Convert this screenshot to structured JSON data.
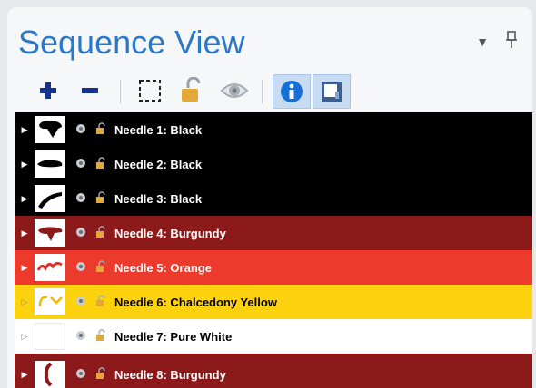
{
  "panel": {
    "title": "Sequence View",
    "menu_icon": "dropdown-arrow-icon",
    "pin_icon": "pin-icon"
  },
  "toolbar": {
    "items": [
      {
        "icon": "plus-icon"
      },
      {
        "icon": "minus-icon"
      },
      {
        "icon": "selection-marquee-icon"
      },
      {
        "icon": "lock-open-icon"
      },
      {
        "icon": "eye-icon"
      },
      {
        "icon": "info-icon",
        "selected": true
      },
      {
        "icon": "image-preview-icon",
        "selected": true
      }
    ]
  },
  "rows": [
    {
      "label": "Needle 1: Black",
      "bg": "#000000",
      "fg": "#ffffff",
      "thumb": "#000000"
    },
    {
      "label": "Needle 2: Black",
      "bg": "#000000",
      "fg": "#ffffff",
      "thumb": "#000000"
    },
    {
      "label": "Needle 3: Black",
      "bg": "#000000",
      "fg": "#ffffff",
      "thumb": "#000000"
    },
    {
      "label": "Needle 4: Burgundy",
      "bg": "#8c1a1a",
      "fg": "#ffffff",
      "thumb": "#8c1a1a"
    },
    {
      "label": "Needle 5: Orange",
      "bg": "#ec3a2c",
      "fg": "#ffffff",
      "thumb": "#e03226"
    },
    {
      "label": "Needle 6: Chalcedony Yellow",
      "bg": "#fcd20f",
      "fg": "#000000",
      "thumb": "#f5b500"
    },
    {
      "label": "Needle 7: Pure White",
      "bg": "#ffffff",
      "fg": "#000000",
      "thumb": "#ffffff"
    },
    {
      "label": "Needle 8: Burgundy",
      "bg": "#8c1a1a",
      "fg": "#ffffff",
      "thumb": "#8c1a1a"
    }
  ]
}
